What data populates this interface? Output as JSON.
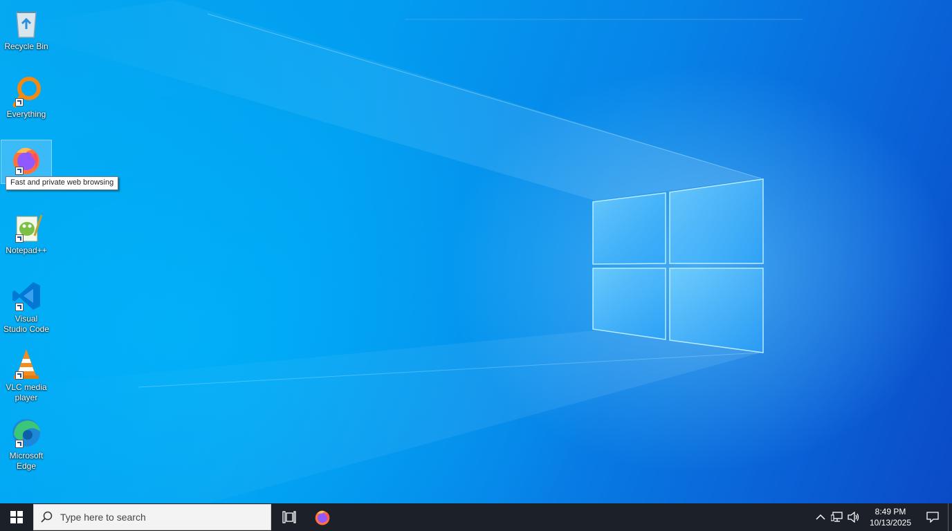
{
  "desktop": {
    "icons": [
      {
        "label": "Recycle Bin",
        "icon": "recycle-bin-icon"
      },
      {
        "label": "Everything",
        "icon": "everything-search-icon"
      },
      {
        "label": "",
        "icon": "firefox-icon"
      },
      {
        "label": "Notepad++",
        "icon": "notepad-plus-plus-icon"
      },
      {
        "label": "Visual Studio Code",
        "icon": "vscode-icon"
      },
      {
        "label": "VLC media player",
        "icon": "vlc-icon"
      },
      {
        "label": "Microsoft Edge",
        "icon": "edge-icon"
      }
    ],
    "tooltip": "Fast and private web browsing"
  },
  "taskbar": {
    "search_placeholder": "Type here to search",
    "pinned": [
      {
        "icon": "firefox-icon"
      }
    ],
    "tray_icons": [
      "chevron-up-icon",
      "network-icon",
      "volume-icon"
    ],
    "clock_time": "8:49 PM",
    "clock_date": "10/13/2025",
    "notification_icon": "notification-icon"
  },
  "colors": {
    "wallpaper_accent": "#0a78d8",
    "taskbar_bg": "#1c2028",
    "search_bg": "#f3f3f3"
  }
}
